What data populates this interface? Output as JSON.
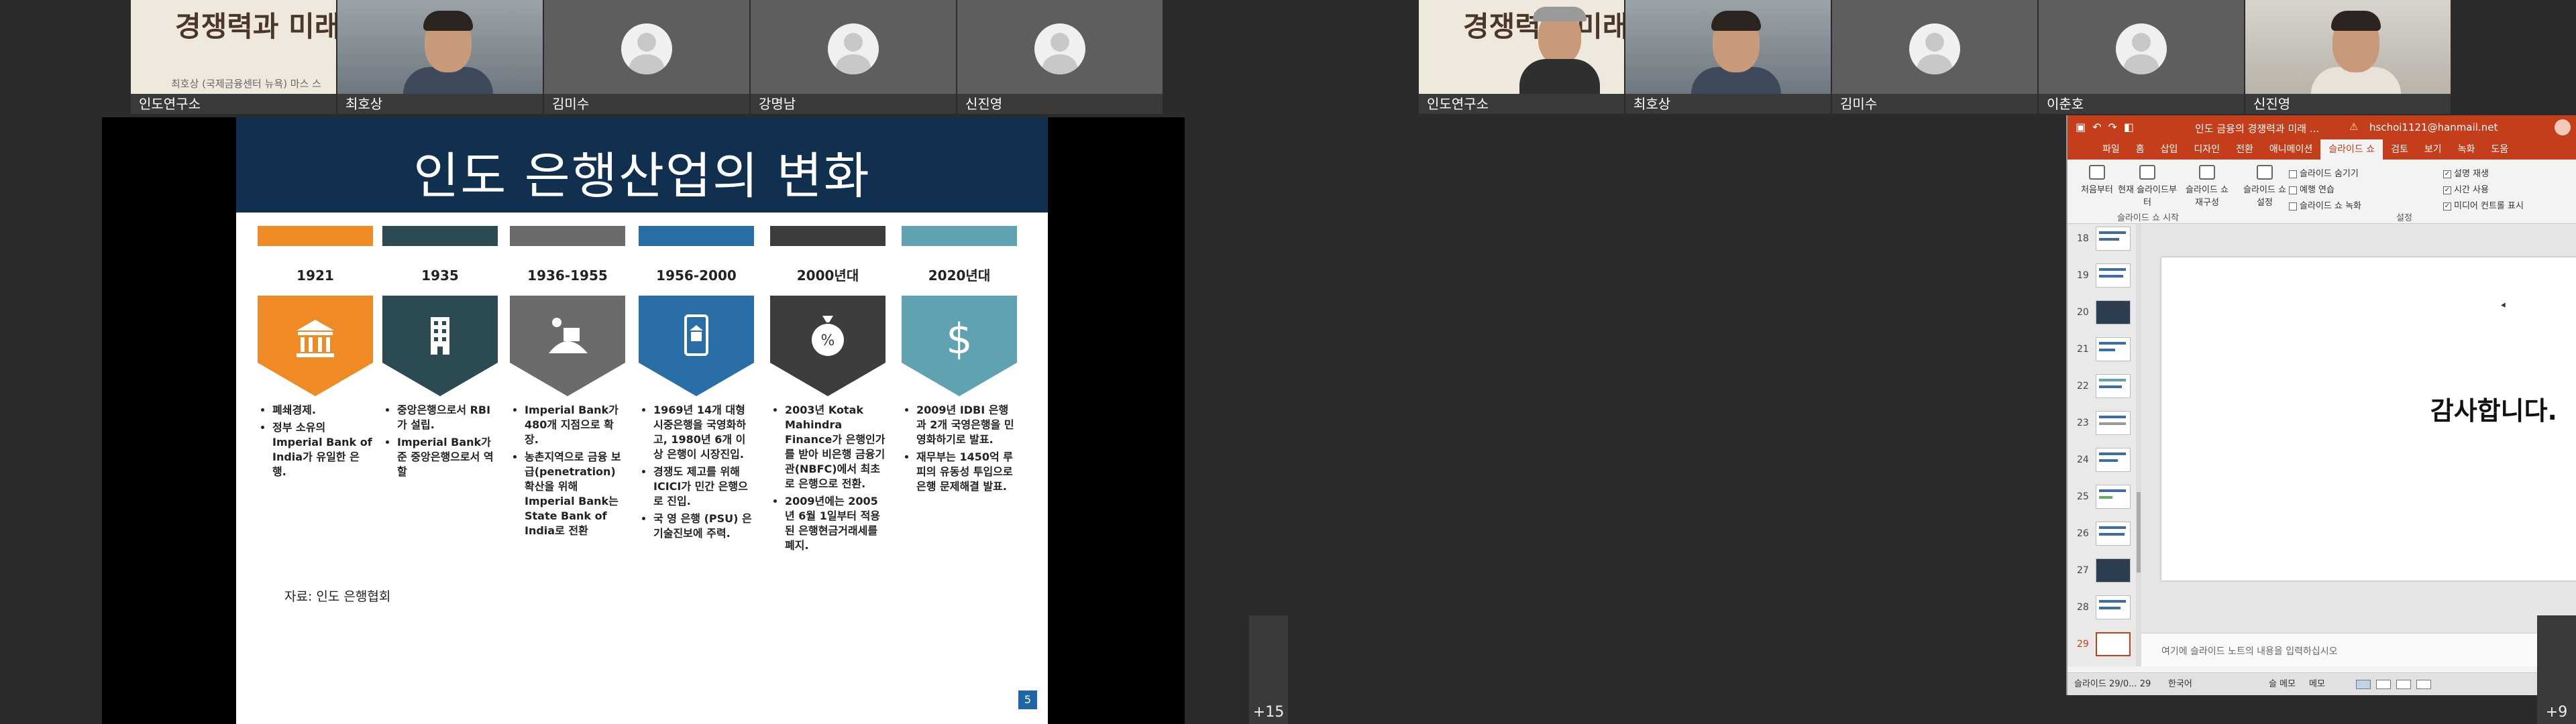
{
  "left_panel": {
    "participants": [
      {
        "name": "인도연구소",
        "kind": "slide",
        "thumb_title": "경쟁력과 미래",
        "thumb_sub": "최호상 (국제금융센터 뉴욕) 마스 스"
      },
      {
        "name": "최호상",
        "kind": "video"
      },
      {
        "name": "김미수",
        "kind": "avatar"
      },
      {
        "name": "강명남",
        "kind": "avatar"
      },
      {
        "name": "신진영",
        "kind": "avatar"
      }
    ],
    "more_label": "+15",
    "slide": {
      "title": "인도 은행산업의 변화",
      "columns": [
        {
          "year": "1921",
          "color": "#f08a24",
          "icon": "bank-icon",
          "bullets": [
            "폐쇄경제.",
            "정부 소유의 Imperial Bank of India가 유일한 은행."
          ]
        },
        {
          "year": "1935",
          "color": "#2c4a52",
          "icon": "building-icon",
          "bullets": [
            "중앙은행으로서 RBI가 설립.",
            "Imperial Bank가 준 중앙은행으로서 역할"
          ]
        },
        {
          "year": "1936-1955",
          "color": "#6b6b6b",
          "icon": "rural-bank-icon",
          "bullets": [
            "Imperial Bank가 480개 지점으로 확장.",
            "농촌지역으로 금융 보급(penetration) 확산을 위해 Imperial Bank는 State Bank of India로 전환"
          ]
        },
        {
          "year": "1956-2000",
          "color": "#2a6ea8",
          "icon": "mobile-bank-icon",
          "bullets": [
            "1969년 14개 대형 시중은행을 국영화하고, 1980년 6개 이상 은행이 시장진입.",
            "경쟁도 제고를 위해 ICICI가 민간 은행으로 진입.",
            "국 영 은행 (PSU) 은 기술진보에 주력."
          ]
        },
        {
          "year": "2000년대",
          "color": "#3d3d3d",
          "icon": "money-bag-icon",
          "bullets": [
            "2003년 Kotak Mahindra Finance가 은행인가를 받아 비은행 금융기관(NBFC)에서 최초로 은행으로 전환.",
            "2009년에는 2005년 6월 1일부터 적용된 은행현금거래세를 폐지."
          ]
        },
        {
          "year": "2020년대",
          "color": "#5fa3b3",
          "icon": "dollar-icon",
          "bullets": [
            "2009년 IDBI 은행과 2개 국영은행을 민영화하기로 발표.",
            "재무부는 1450억 루피의 유동성 투입으로 은행 문제해결 발표."
          ]
        }
      ],
      "source": "자료: 인도 은행협회",
      "page_number": "5"
    }
  },
  "right_panel": {
    "participants": [
      {
        "name": "인도연구소",
        "kind": "slide-face",
        "thumb_title": "경쟁력과 미래"
      },
      {
        "name": "최호상",
        "kind": "video"
      },
      {
        "name": "김미수",
        "kind": "avatar"
      },
      {
        "name": "이춘호",
        "kind": "avatar"
      },
      {
        "name": "신진영",
        "kind": "video-light"
      }
    ],
    "more_label": "+9",
    "ppt": {
      "document_title": "인도 금융의 경쟁력과 미래 ...",
      "user": "hschoi1121@hanmail.net",
      "tabs": [
        "파일",
        "홈",
        "삽입",
        "디자인",
        "전환",
        "애니메이션",
        "슬라이드 쇼",
        "검토",
        "보기",
        "녹화",
        "도움"
      ],
      "active_tab": "슬라이드 쇼",
      "ribbon": {
        "from_start": "처음부터",
        "from_current": "현재 슬라이드부터",
        "custom_show": "슬라이드 쇼 재구성",
        "setup": "슬라이드 쇼 설정",
        "hide_slide": "슬라이드 숨기기",
        "rehearse": "예행 연습",
        "record": "슬라이드 쇼 녹화",
        "group_start": "슬라이드 쇼 시작",
        "group_setup": "설정",
        "check_narration": "설명 재생",
        "check_timing": "시간 사용",
        "check_media": "미디어 컨트롤 표시"
      },
      "thumbnails": [
        "18",
        "19",
        "20",
        "21",
        "22",
        "23",
        "24",
        "25",
        "26",
        "27",
        "28",
        "29"
      ],
      "active_thumbnail": "29",
      "slide_text": "감사합니다.",
      "notes_placeholder": "여기에 슬라이드 노트의 내용을 입력하십시오",
      "status_slide": "슬라이드 29/0... 29",
      "status_lang": "한국어",
      "status_notes": "슬 메모",
      "status_comments": "메모"
    }
  }
}
